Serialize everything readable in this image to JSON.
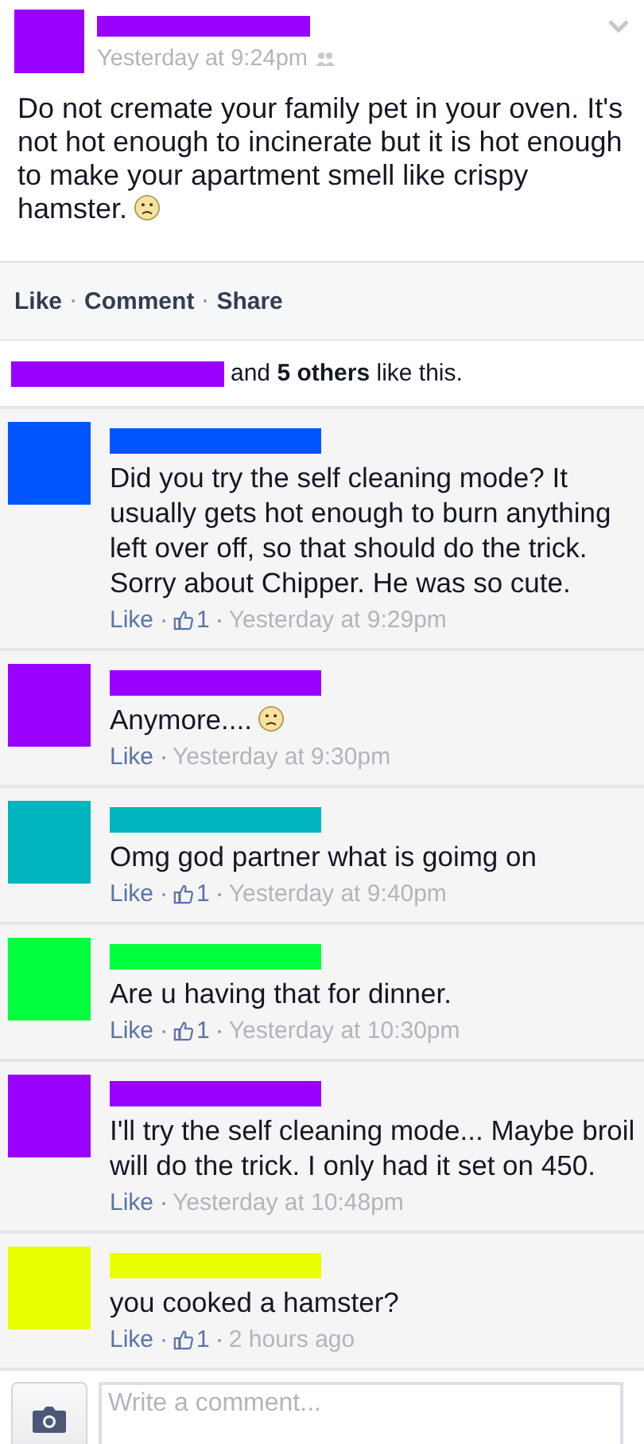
{
  "post": {
    "color": "#9900ff",
    "time": "Yesterday at 9:24pm",
    "text": "Do not cremate your family pet in your oven. It's not hot enough to incinerate but it is hot enough to make your apartment smell like crispy hamster.",
    "frown_emoji": true
  },
  "actions": [
    "Like",
    "Comment",
    "Share"
  ],
  "likes": {
    "color": "#9900ff",
    "text": "and **5 others** like this."
  },
  "comments": [
    {
      "color": "#0055ff",
      "text": "Did you try the self cleaning mode? It usually gets hot enough to burn anything left over off, so that should do the trick. Sorry about Chipper. He was so cute.",
      "frown_emoji": false,
      "like": "Like",
      "like_count": "1",
      "time": "Yesterday at 9:29pm"
    },
    {
      "color": "#9900ff",
      "text": "Anymore....",
      "frown_emoji": true,
      "like": "Like",
      "time": "Yesterday at 9:30pm"
    },
    {
      "color": "#00b5be",
      "text": "Omg god partner what is goimg on",
      "frown_emoji": false,
      "like": "Like",
      "like_count": "1",
      "time": "Yesterday at 9:40pm"
    },
    {
      "color": "#00ff3c",
      "text": "Are u having that for dinner.",
      "frown_emoji": false,
      "like": "Like",
      "like_count": "1",
      "time": "Yesterday at 10:30pm"
    },
    {
      "color": "#9900ff",
      "text": "I'll try the self cleaning mode... Maybe broil will do the trick. I only had it set on 450.",
      "frown_emoji": false,
      "like": "Like",
      "time": "Yesterday at 10:48pm"
    },
    {
      "color": "#eaff00",
      "text": "you cooked a hamster?",
      "frown_emoji": false,
      "like": "Like",
      "like_count": "1",
      "time": "2 hours ago"
    }
  ],
  "composer": {
    "placeholder": "Write a comment..."
  }
}
